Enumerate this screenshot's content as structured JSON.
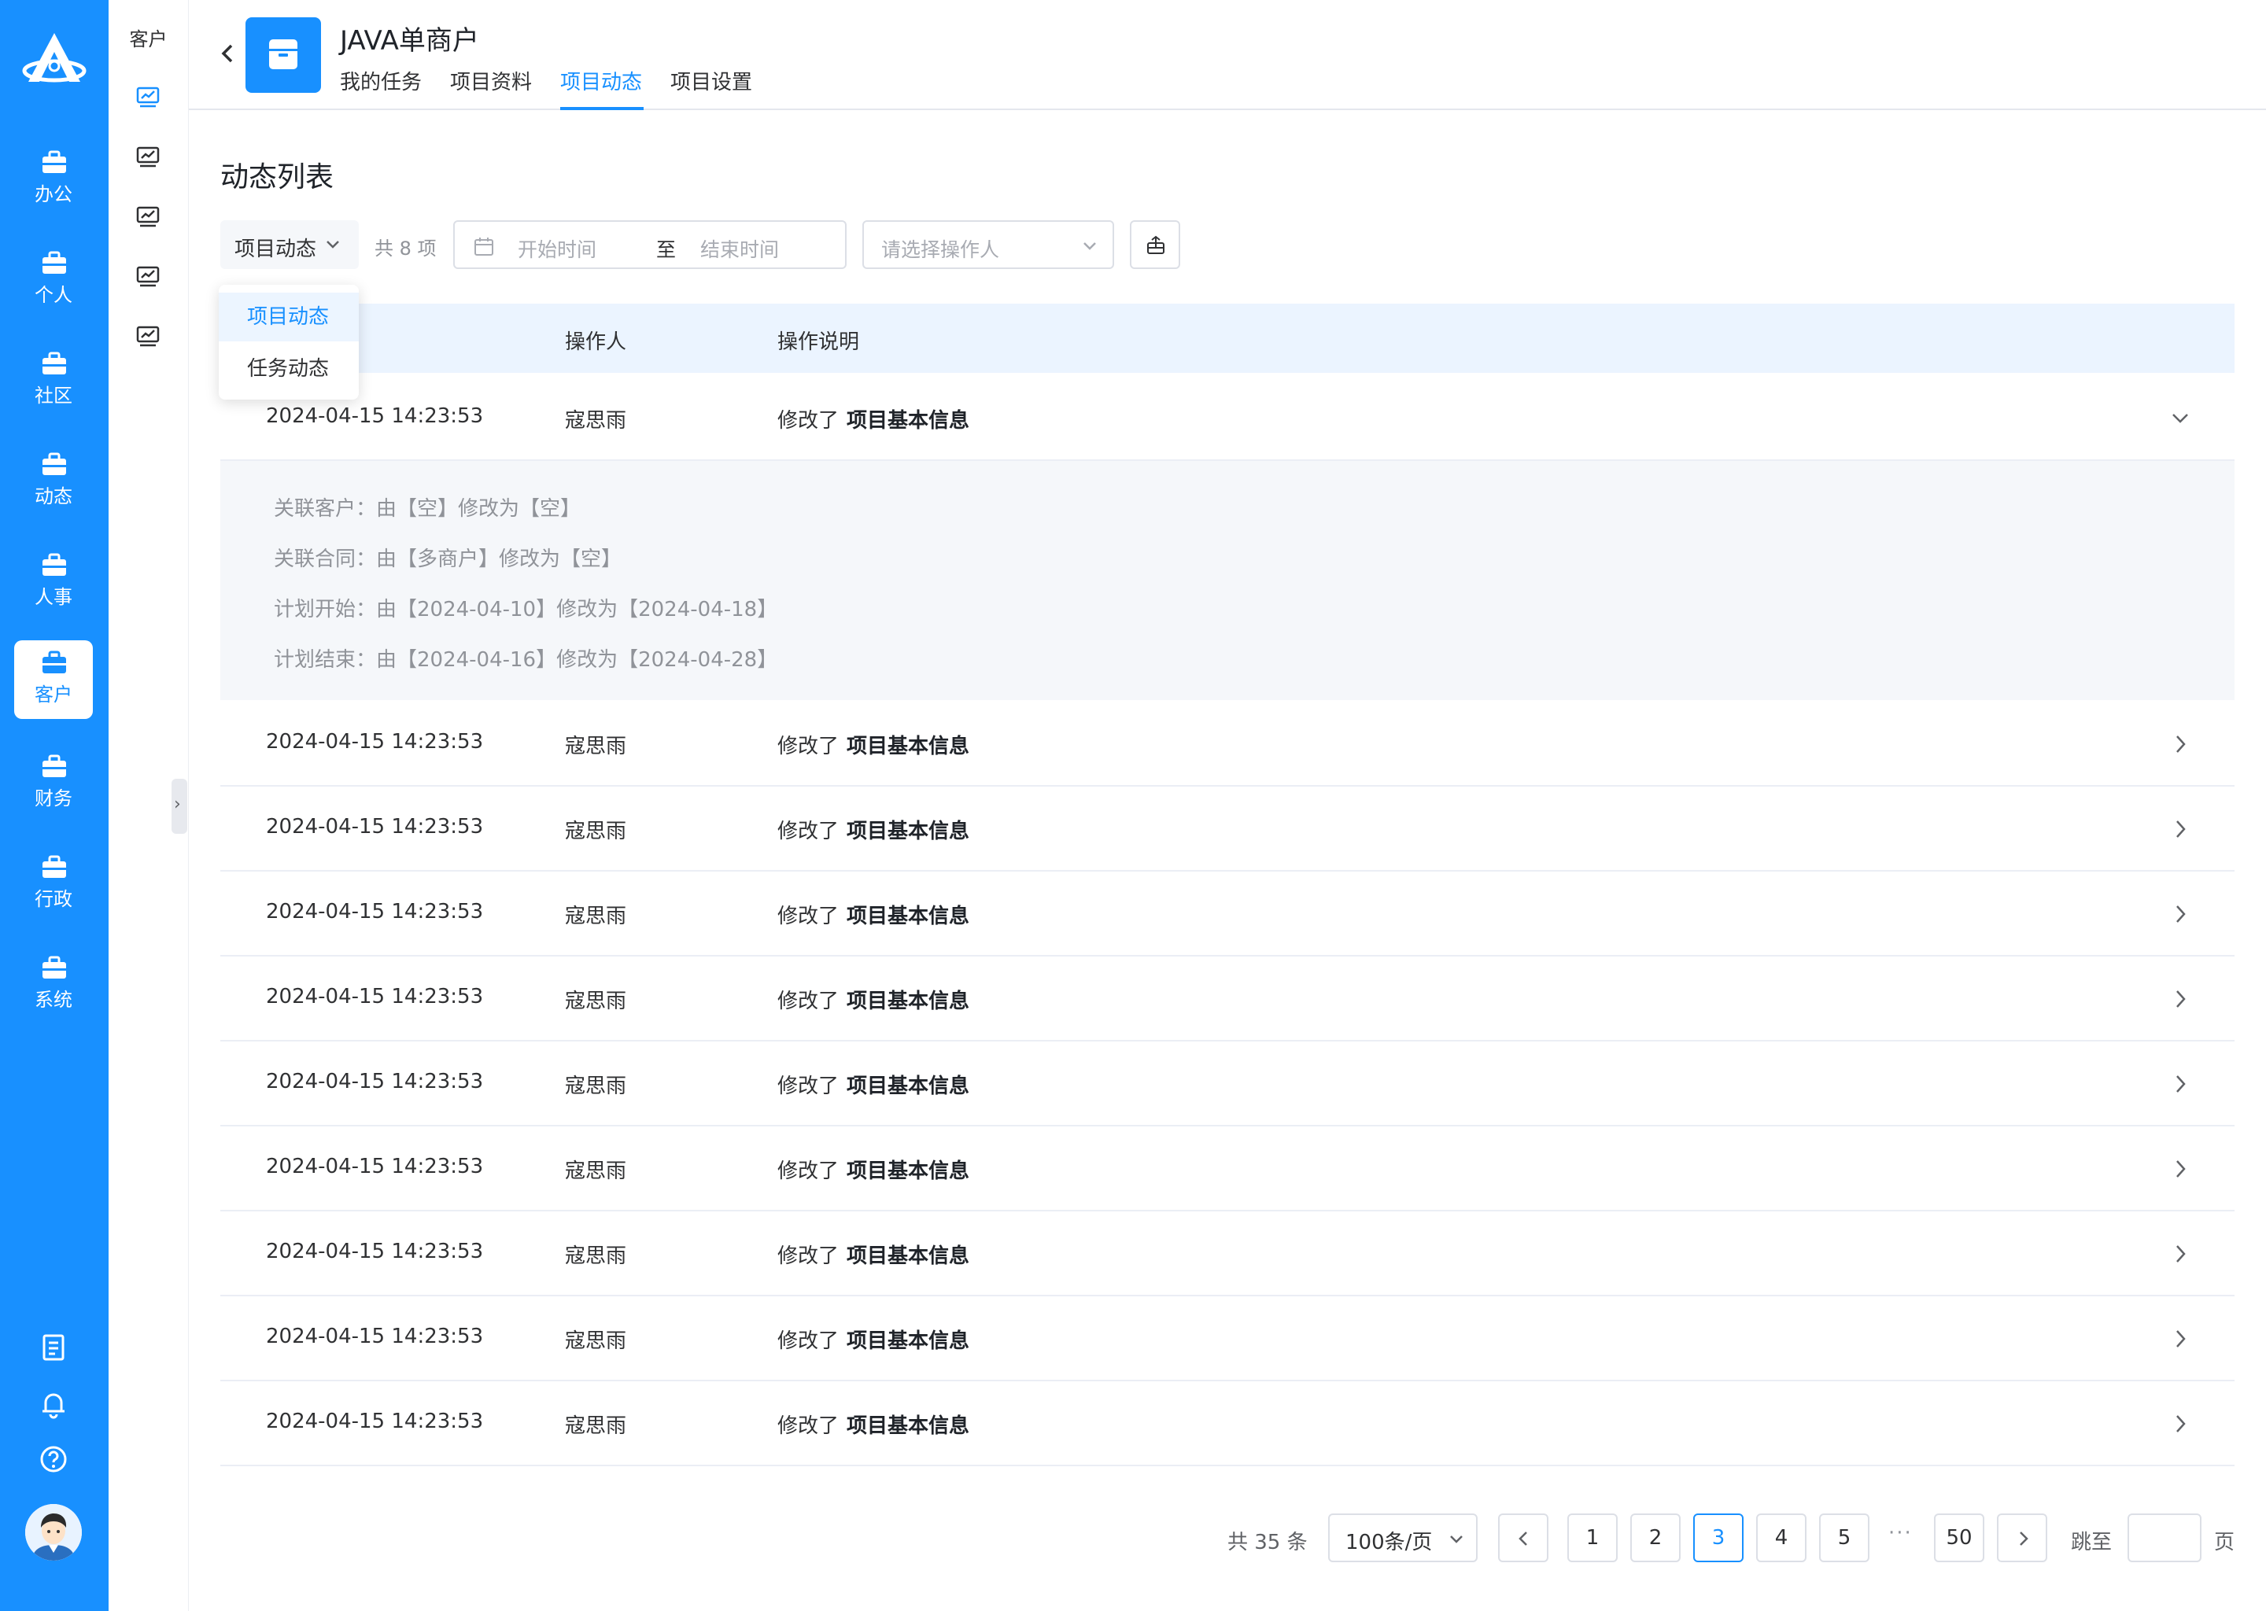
{
  "sidebar": {
    "logo_icon": "crmeb-logo-icon",
    "items": [
      {
        "label": "办公",
        "icon": "briefcase-icon"
      },
      {
        "label": "个人",
        "icon": "briefcase-icon"
      },
      {
        "label": "社区",
        "icon": "briefcase-icon"
      },
      {
        "label": "动态",
        "icon": "briefcase-icon"
      },
      {
        "label": "人事",
        "icon": "briefcase-icon"
      },
      {
        "label": "客户",
        "icon": "briefcase-icon",
        "active": true
      },
      {
        "label": "财务",
        "icon": "briefcase-icon"
      },
      {
        "label": "行政",
        "icon": "briefcase-icon"
      },
      {
        "label": "系统",
        "icon": "briefcase-icon"
      }
    ],
    "tools": [
      "notebook-icon",
      "bell-icon",
      "help-icon"
    ],
    "avatar_icon": "user-avatar"
  },
  "subbar": {
    "title": "客户",
    "icons": [
      "chart-monitor-icon",
      "chart-monitor-icon",
      "chart-monitor-icon",
      "chart-monitor-icon",
      "chart-monitor-icon"
    ]
  },
  "header": {
    "project_title": "JAVA单商户",
    "tabs": [
      {
        "label": "我的任务"
      },
      {
        "label": "项目资料"
      },
      {
        "label": "项目动态",
        "active": true
      },
      {
        "label": "项目设置"
      }
    ]
  },
  "section": {
    "title": "动态列表",
    "filter_type": "项目动态",
    "total_items": "共 8 项",
    "date_start_placeholder": "开始时间",
    "date_separator": "至",
    "date_end_placeholder": "结束时间",
    "operator_placeholder": "请选择操作人"
  },
  "dropdown": {
    "options": [
      {
        "label": "项目动态",
        "selected": true
      },
      {
        "label": "任务动态"
      }
    ]
  },
  "table": {
    "columns": [
      "操作人",
      "操作说明"
    ],
    "rows": [
      {
        "time": "2024-04-15 14:23:53",
        "operator": "寇思雨",
        "action": "修改了",
        "target": "项目基本信息",
        "expanded": true
      },
      {
        "time": "2024-04-15 14:23:53",
        "operator": "寇思雨",
        "action": "修改了",
        "target": "项目基本信息"
      },
      {
        "time": "2024-04-15 14:23:53",
        "operator": "寇思雨",
        "action": "修改了",
        "target": "项目基本信息"
      },
      {
        "time": "2024-04-15 14:23:53",
        "operator": "寇思雨",
        "action": "修改了",
        "target": "项目基本信息"
      },
      {
        "time": "2024-04-15 14:23:53",
        "operator": "寇思雨",
        "action": "修改了",
        "target": "项目基本信息"
      },
      {
        "time": "2024-04-15 14:23:53",
        "operator": "寇思雨",
        "action": "修改了",
        "target": "项目基本信息"
      },
      {
        "time": "2024-04-15 14:23:53",
        "operator": "寇思雨",
        "action": "修改了",
        "target": "项目基本信息"
      },
      {
        "time": "2024-04-15 14:23:53",
        "operator": "寇思雨",
        "action": "修改了",
        "target": "项目基本信息"
      },
      {
        "time": "2024-04-15 14:23:53",
        "operator": "寇思雨",
        "action": "修改了",
        "target": "项目基本信息"
      },
      {
        "time": "2024-04-15 14:23:53",
        "operator": "寇思雨",
        "action": "修改了",
        "target": "项目基本信息"
      }
    ],
    "detail_lines": [
      "关联客户：由【空】修改为【空】",
      "关联合同：由【多商户】修改为【空】",
      "计划开始：由【2024-04-10】修改为【2024-04-18】",
      "计划结束：由【2024-04-16】修改为【2024-04-28】"
    ]
  },
  "pagination": {
    "total": "共 35 条",
    "page_size": "100条/页",
    "pages": [
      "1",
      "2",
      "3",
      "4",
      "5"
    ],
    "current_page": "3",
    "ellipsis": "···",
    "last_page": "50",
    "goto_label": "跳至",
    "page_suffix": "页"
  },
  "colors": {
    "primary": "#1890ff",
    "header_row_bg": "#ebf4ff",
    "detail_bg": "#f5f7fa"
  }
}
